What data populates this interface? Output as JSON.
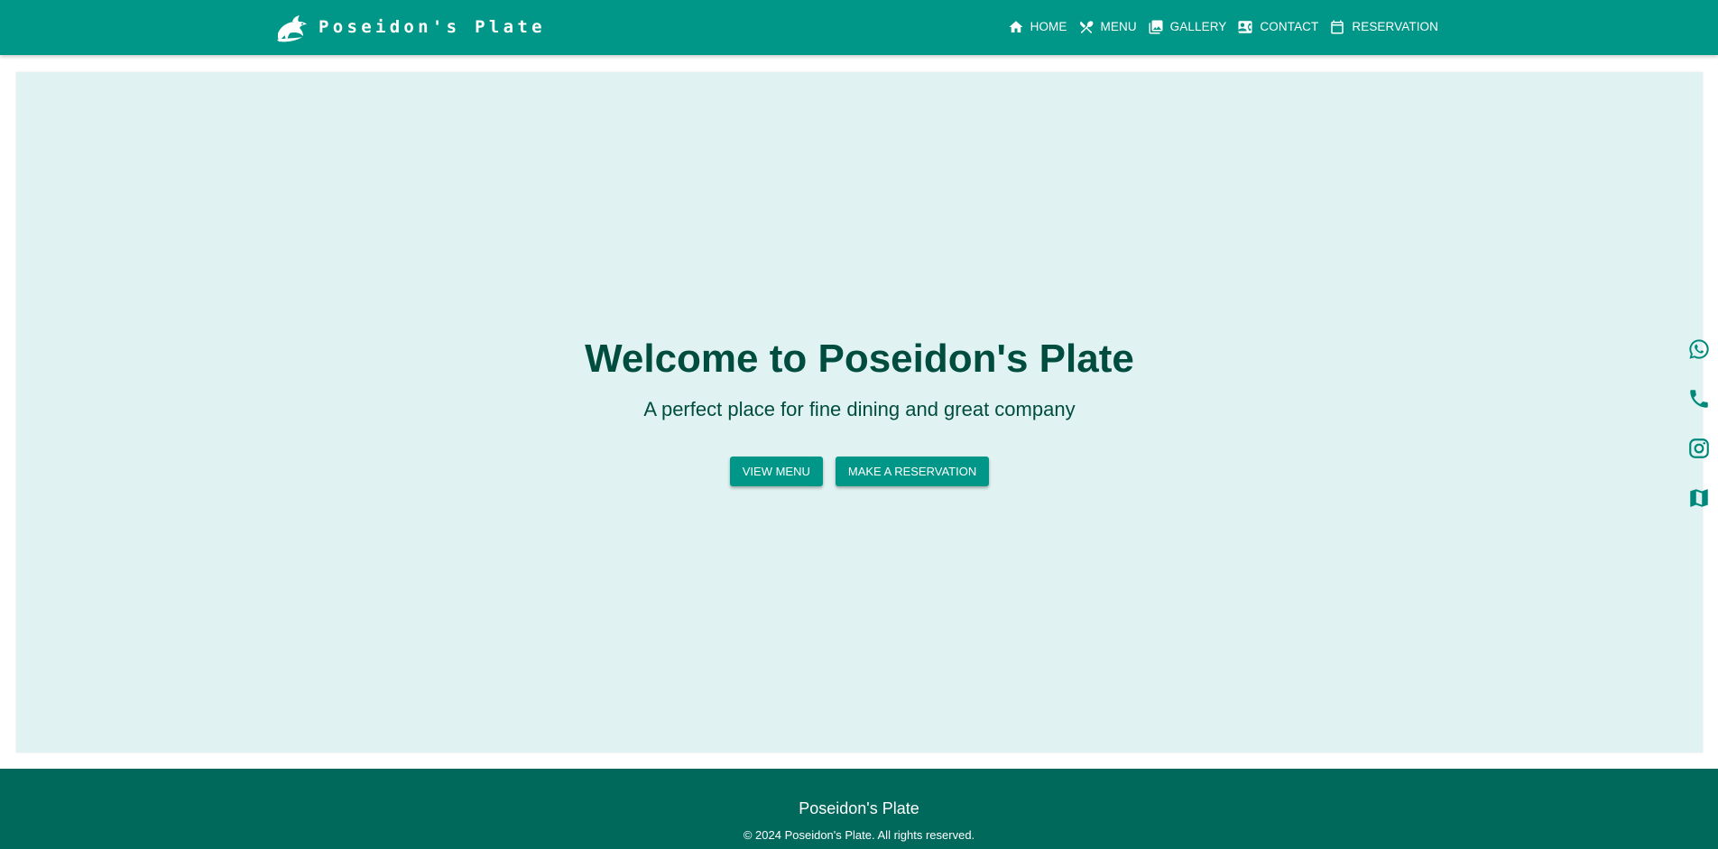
{
  "header": {
    "brand": "Poseidon's Plate",
    "logo_icon": "dolphin-icon",
    "nav": [
      {
        "label": "HOME",
        "icon": "home-icon"
      },
      {
        "label": "MENU",
        "icon": "restaurant-icon"
      },
      {
        "label": "GALLERY",
        "icon": "gallery-icon"
      },
      {
        "label": "CONTACT",
        "icon": "contact-card-icon"
      },
      {
        "label": "RESERVATION",
        "icon": "calendar-icon"
      }
    ]
  },
  "hero": {
    "title": "Welcome to Poseidon's Plate",
    "subtitle": "A perfect place for fine dining and great company",
    "buttons": {
      "view_menu": "VIEW MENU",
      "reservation": "MAKE A RESERVATION"
    }
  },
  "side_icons": [
    "whatsapp-icon",
    "phone-icon",
    "instagram-icon",
    "map-icon"
  ],
  "footer": {
    "title": "Poseidon's Plate",
    "copyright": "© 2024 Poseidon's Plate. All rights reserved."
  },
  "colors": {
    "primary": "#009688",
    "hero_background": "#e0f2f1",
    "text_dark": "#004d40",
    "footer": "#00695c"
  }
}
